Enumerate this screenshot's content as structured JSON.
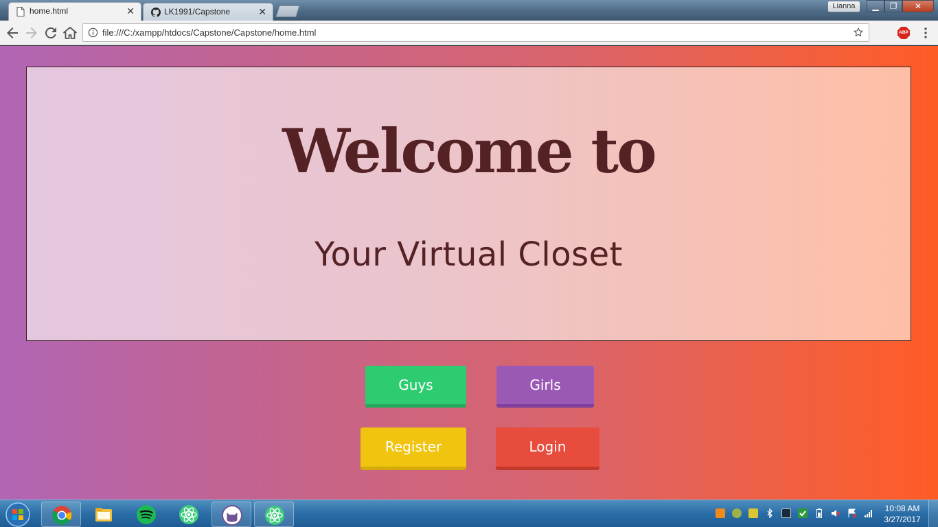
{
  "browser": {
    "tabs": [
      {
        "label": "home.html",
        "icon": "page-icon",
        "active": true
      },
      {
        "label": "LK1991/Capstone",
        "icon": "github-icon",
        "active": false
      }
    ],
    "tab_close_glyph": "✕",
    "user_name": "Lianna",
    "window_controls": {
      "minimize": "▁",
      "maximize": "❐",
      "close": "✕"
    },
    "url": "file:///C:/xampp/htdocs/Capstone/Capstone/home.html",
    "extension_badge": "ABP"
  },
  "page": {
    "title": "Welcome to",
    "subtitle": "Your Virtual Closet",
    "buttons": {
      "guys": "Guys",
      "girls": "Girls",
      "register": "Register",
      "login": "Login"
    },
    "colors": {
      "guys": "#2ecc71",
      "girls": "#9b59b6",
      "register": "#f1c40f",
      "login": "#e74c3c",
      "heading_text": "#542124"
    }
  },
  "taskbar": {
    "apps": [
      "chrome-icon",
      "file-explorer-icon",
      "spotify-icon",
      "atom-icon",
      "github-desktop-icon",
      "atom-icon"
    ],
    "clock_time": "10:08 AM",
    "clock_date": "3/27/2017"
  }
}
